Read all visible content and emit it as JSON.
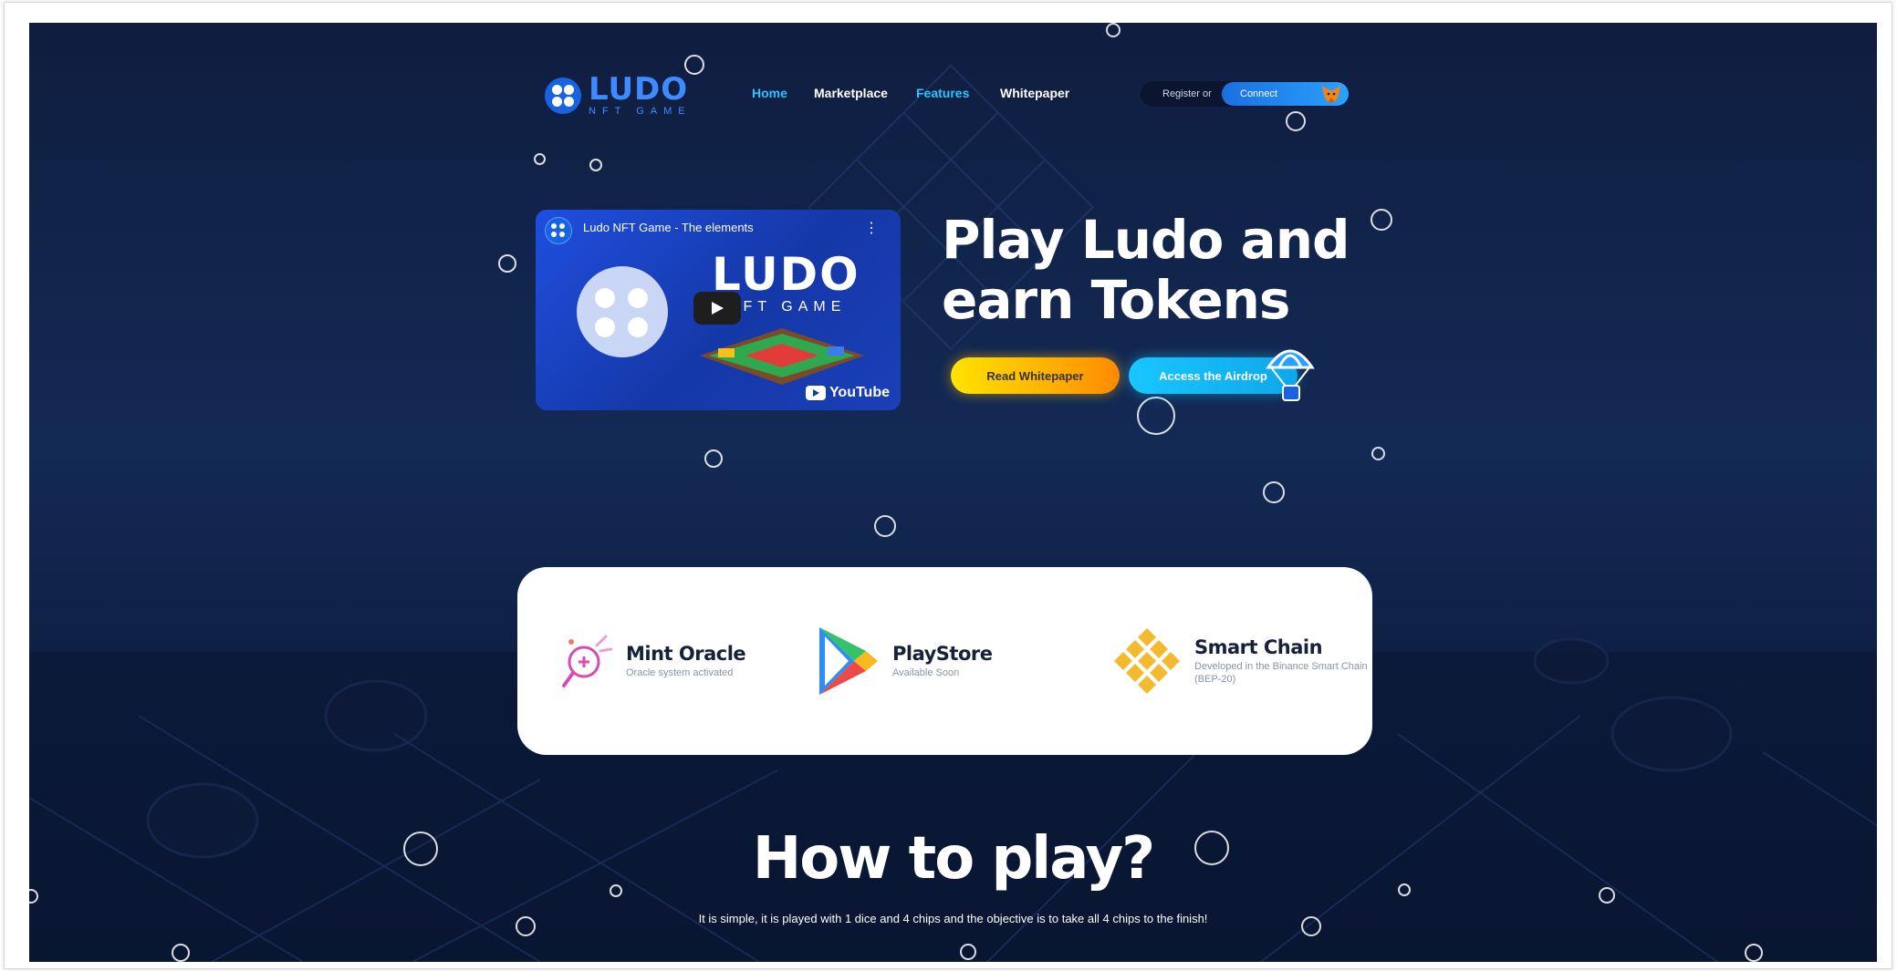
{
  "brand": {
    "name": "LUDO",
    "sub": "NFT GAME"
  },
  "nav": {
    "items": [
      {
        "label": "Home",
        "color": "#26c6ff"
      },
      {
        "label": "Marketplace",
        "color": "#ffffff"
      },
      {
        "label": "Features",
        "color": "#26c6ff"
      },
      {
        "label": "Whitepaper",
        "color": "#ffffff"
      }
    ]
  },
  "auth": {
    "register": "Register or",
    "connect": "Connect"
  },
  "video": {
    "title": "Ludo NFT Game - The elements",
    "logo": "LUDO",
    "logo_sub": "NFT GAME",
    "platform": "YouTube"
  },
  "hero": {
    "title_line1": "Play Ludo and",
    "title_line2": "earn Tokens",
    "btn_whitepaper": "Read Whitepaper",
    "btn_airdrop": "Access the Airdrop"
  },
  "features": [
    {
      "title": "Mint Oracle",
      "desc": "Oracle system activated",
      "icon": "oracle-wand-icon"
    },
    {
      "title": "PlayStore",
      "desc": "Available Soon",
      "icon": "google-play-icon"
    },
    {
      "title": "Smart Chain",
      "desc": "Developed in the Binance Smart Chain (BEP-20)",
      "icon": "binance-icon"
    }
  ],
  "how_to_play": {
    "title": "How to play?",
    "subtitle": "It is simple, it is played with 1 dice and 4 chips and the objective is to take all 4 chips to the finish!"
  }
}
